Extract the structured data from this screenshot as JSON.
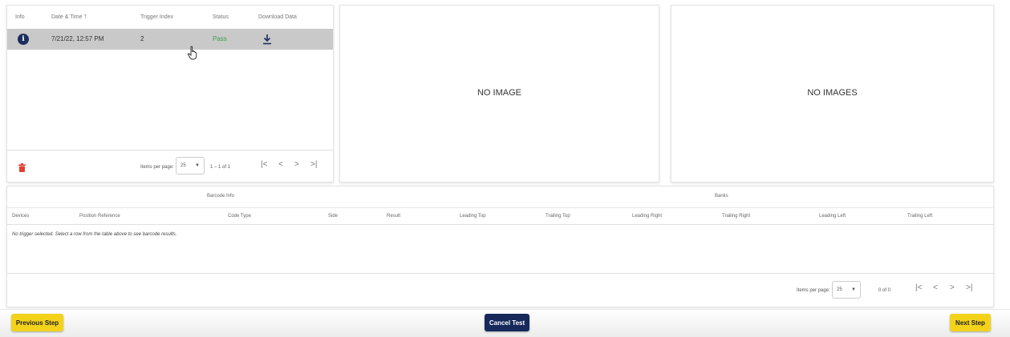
{
  "trigger_table": {
    "columns": {
      "info": "Info",
      "date_time": "Date & Time",
      "sort_arrow": "🡑",
      "trigger_index": "Trigger Index",
      "status": "Status",
      "download": "Download Data"
    },
    "rows": [
      {
        "info_icon": "i",
        "date_time": "7/21/22, 12:57 PM",
        "trigger_index": "2",
        "status": "Pass",
        "status_color": "#3aa14a",
        "download_icon": "download-icon"
      }
    ],
    "footer": {
      "delete_icon": "trash-icon",
      "items_per_page_label": "Items per page:",
      "items_per_page_value": "25",
      "range_label": "1 – 1 of 1",
      "first": "|<",
      "prev": "<",
      "next": ">",
      "last": ">|"
    }
  },
  "image_panel": {
    "text": "NO IMAGE"
  },
  "images_panel": {
    "text": "NO IMAGES"
  },
  "barcode_table": {
    "group_headers": {
      "barcode_info": "Barcode Info",
      "banks": "Banks"
    },
    "columns": {
      "devices": "Devices",
      "position_reference": "Position Reference",
      "code_type": "Code Type",
      "side": "Side",
      "result": "Result",
      "leading_top": "Leading Top",
      "trailing_top": "Trailing Top",
      "leading_right": "Leading Right",
      "trailing_right": "Trailing Right",
      "leading_left": "Leading Left",
      "trailing_left": "Trailing Left"
    },
    "empty_message": "No trigger selected. Select a row from the table above to see barcode results.",
    "footer": {
      "items_per_page_label": "Items per page:",
      "items_per_page_value": "25",
      "range_label": "0 of 0",
      "first": "|<",
      "prev": "<",
      "next": ">",
      "last": ">|"
    }
  },
  "bottom_bar": {
    "previous_step": "Previous Step",
    "cancel_test": "Cancel Test",
    "next_step": "Next Step"
  },
  "colors": {
    "accent_yellow": "#f3d21b",
    "navy": "#16295a",
    "selected_row": "#c9c9c9",
    "delete_red": "#e0402e"
  }
}
